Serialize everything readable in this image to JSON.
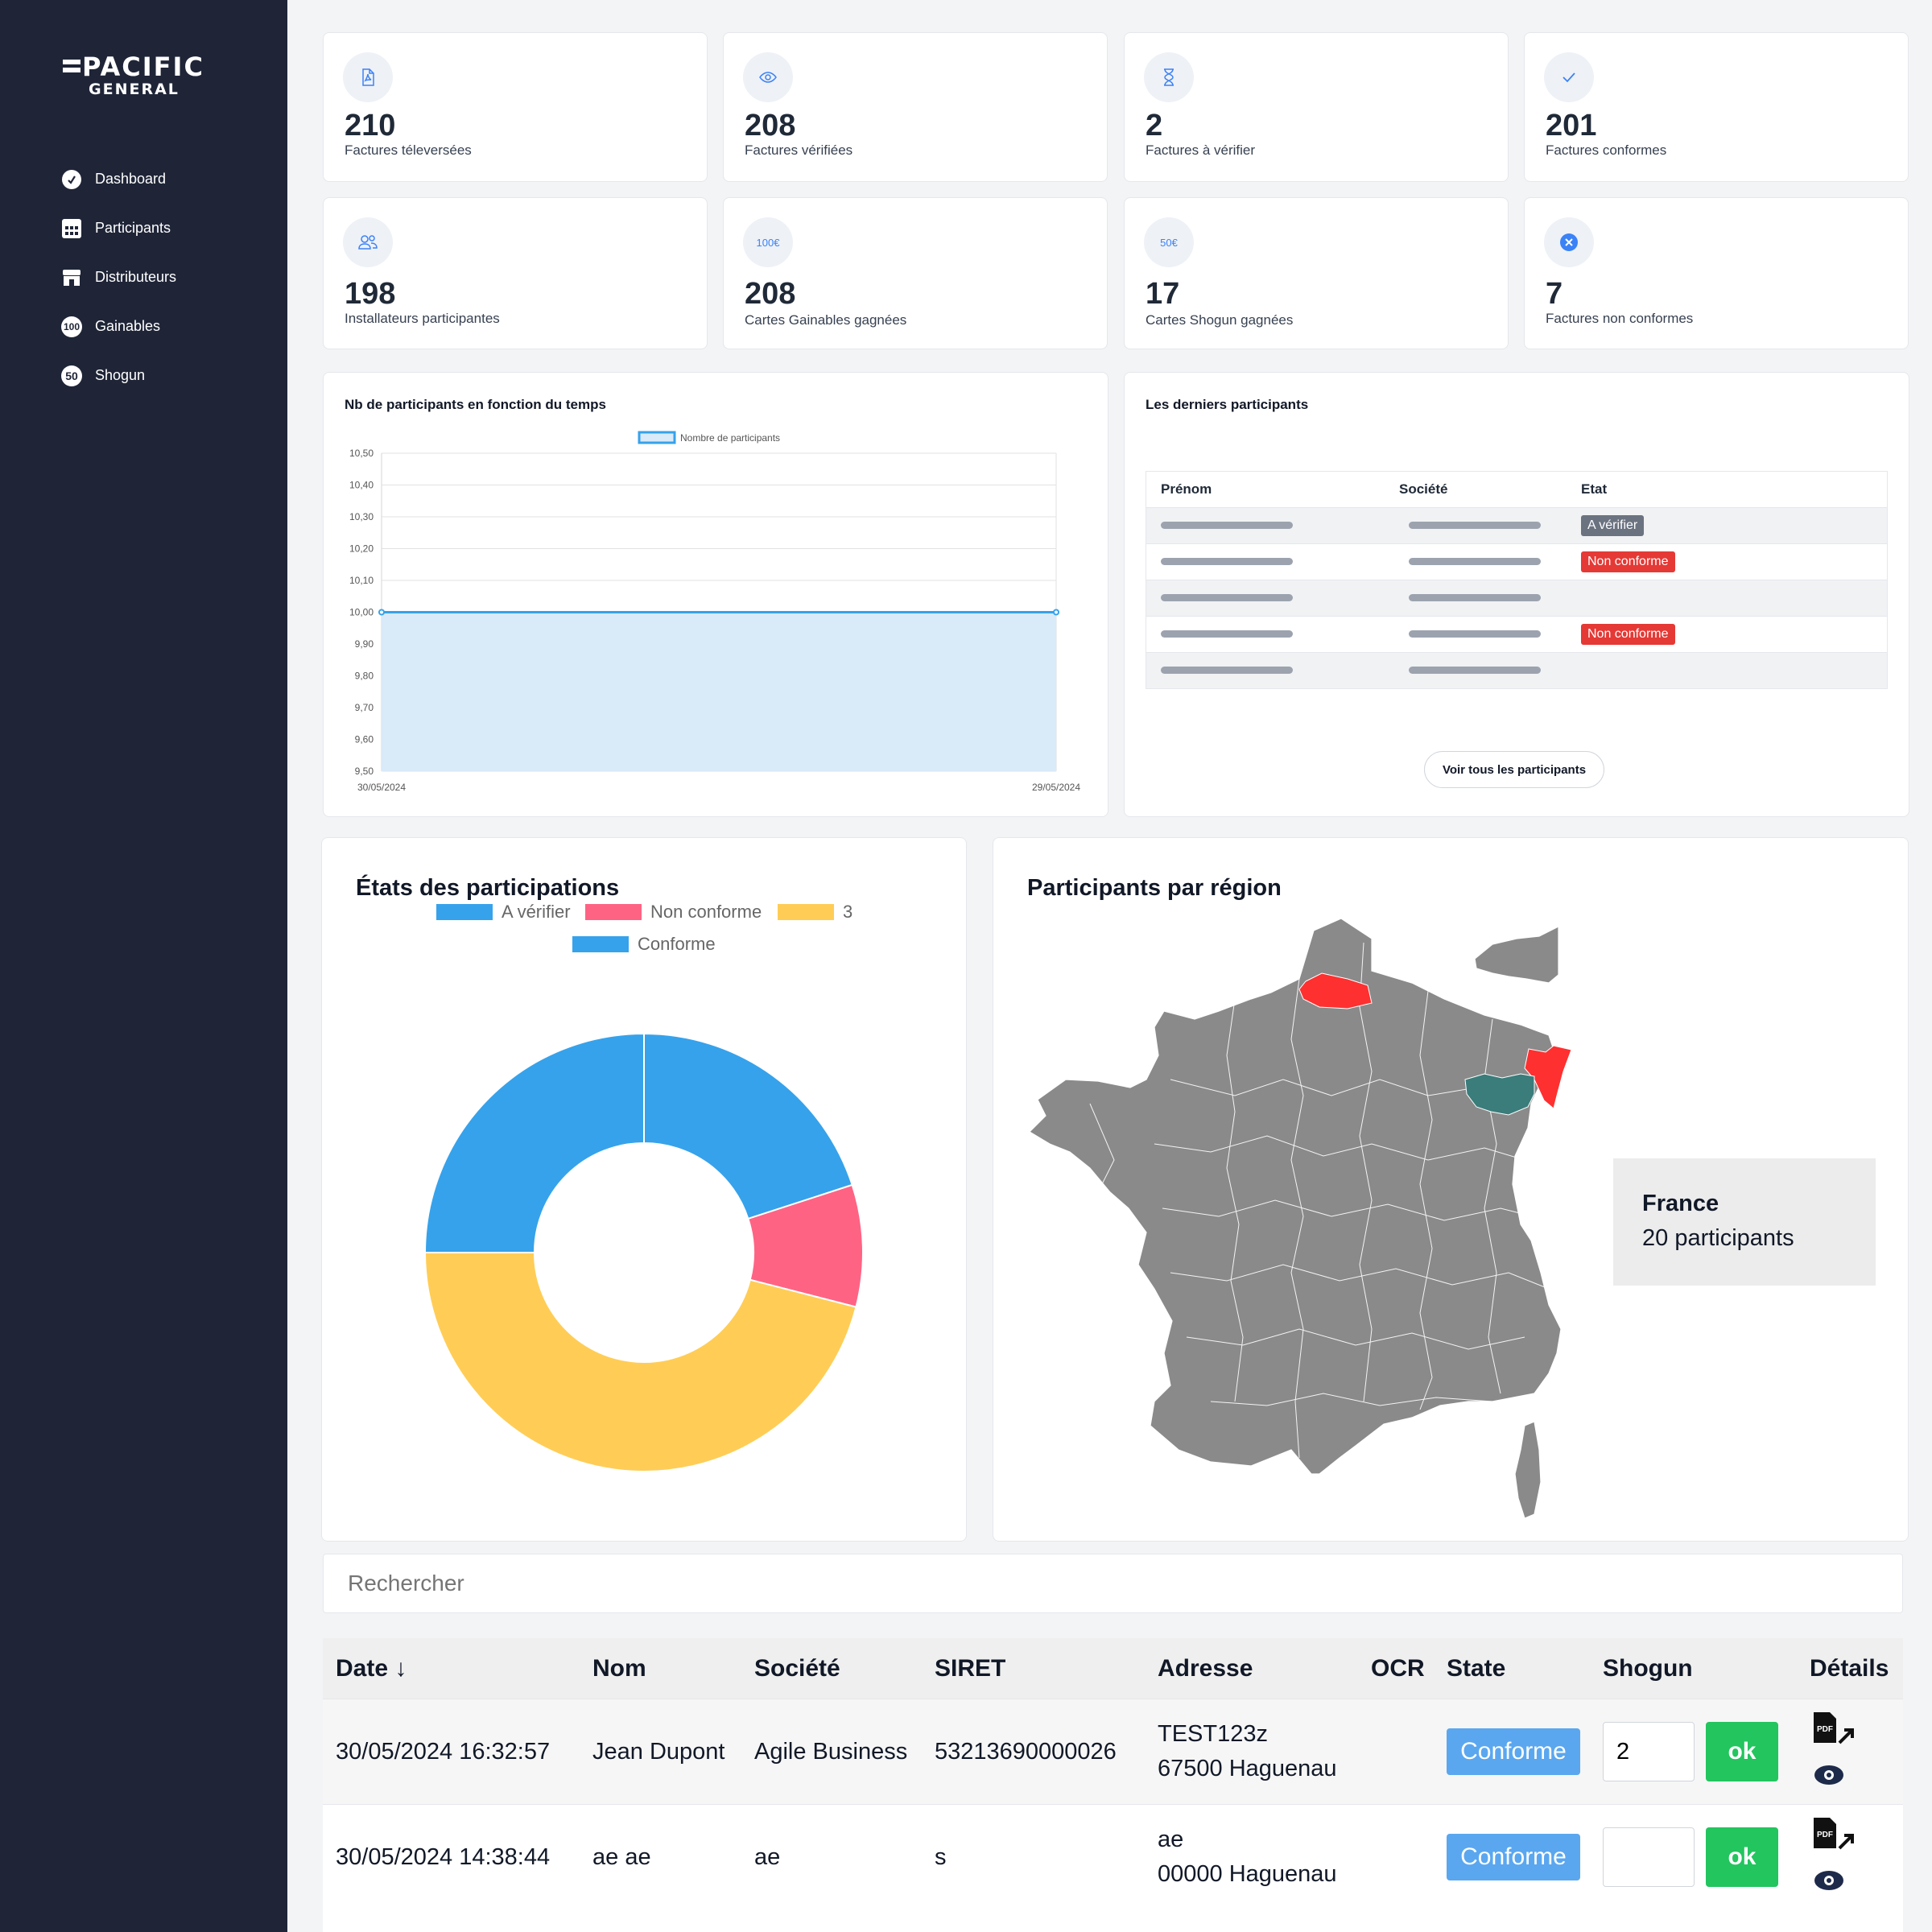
{
  "brand": {
    "line1": "PACIFIC",
    "line2": "GENERAL"
  },
  "nav": [
    {
      "label": "Dashboard",
      "icon": "gauge-icon"
    },
    {
      "label": "Participants",
      "icon": "grid-icon"
    },
    {
      "label": "Distributeurs",
      "icon": "store-icon"
    },
    {
      "label": "Gainables",
      "icon": "badge-100-icon",
      "badge": "100"
    },
    {
      "label": "Shogun",
      "icon": "badge-50-icon",
      "badge": "50"
    }
  ],
  "stats": [
    {
      "value": "210",
      "label": "Factures téleversées",
      "icon": "pdf-file-icon"
    },
    {
      "value": "208",
      "label": "Factures vérifiées",
      "icon": "eye-icon"
    },
    {
      "value": "2",
      "label": "Factures à vérifier",
      "icon": "hourglass-icon"
    },
    {
      "value": "201",
      "label": "Factures conformes",
      "icon": "check-icon"
    },
    {
      "value": "198",
      "label": "Installateurs participantes",
      "icon": "users-icon"
    },
    {
      "value": "208",
      "label": "Cartes Gainables gagnées",
      "icon": "amount-100-icon",
      "icon_text": "100€"
    },
    {
      "value": "17",
      "label": "Cartes Shogun gagnées",
      "icon": "amount-50-icon",
      "icon_text": "50€"
    },
    {
      "value": "7",
      "label": "Factures non conformes",
      "icon": "x-circle-icon"
    }
  ],
  "line_card": {
    "title": "Nb de participants en fonction du temps"
  },
  "recent": {
    "title": "Les derniers participants",
    "headers": [
      "Prénom",
      "Société",
      "Etat"
    ],
    "rows": [
      {
        "etat": "A vérifier",
        "kind": "grey"
      },
      {
        "etat": "Non conforme",
        "kind": "red"
      },
      {
        "etat": "",
        "kind": ""
      },
      {
        "etat": "Non conforme",
        "kind": "red"
      },
      {
        "etat": "",
        "kind": ""
      }
    ],
    "button": "Voir tous les participants"
  },
  "donut_card": {
    "title": "États des participations"
  },
  "map_card": {
    "title": "Participants par région",
    "info_title": "France",
    "info_value": "20 participants",
    "colors": {
      "base": "#8a8a8a",
      "red": "#ff3030",
      "teal": "#3a7d7b"
    }
  },
  "search": {
    "placeholder": "Rechercher"
  },
  "table": {
    "headers": {
      "date": "Date ↓",
      "nom": "Nom",
      "societe": "Société",
      "siret": "SIRET",
      "adresse": "Adresse",
      "ocr": "OCR",
      "state": "State",
      "shogun": "Shogun",
      "details": "Détails"
    },
    "rows": [
      {
        "date": "30/05/2024 16:32:57",
        "nom": "Jean Dupont",
        "societe": "Agile Business",
        "siret": "53213690000026",
        "adresse1": "TEST123z",
        "adresse2": "67500 Haguenau",
        "state": "Conforme",
        "shogun": "2",
        "ok": "ok"
      },
      {
        "date": "30/05/2024 14:38:44",
        "nom": "ae ae",
        "societe": "ae",
        "siret": "s",
        "adresse1": "ae",
        "adresse2": "00000 Haguenau",
        "state": "Conforme",
        "shogun": "",
        "ok": "ok"
      }
    ]
  },
  "chart_data": [
    {
      "type": "line",
      "title": "Nb de participants en fonction du temps",
      "x": [
        "30/05/2024",
        "29/05/2024"
      ],
      "series": [
        {
          "name": "Nombre de participants",
          "values": [
            10,
            10
          ]
        }
      ],
      "ylim": [
        9.5,
        10.5
      ],
      "yticks": [
        "10,50",
        "10,40",
        "10,30",
        "10,20",
        "10,10",
        "10,00",
        "9,90",
        "9,80",
        "9,70",
        "9,60",
        "9,50"
      ],
      "fill": true,
      "grid": true,
      "legend": "top",
      "colors": {
        "line": "#36a2eb",
        "fill": "#d9eaf9"
      }
    },
    {
      "type": "pie",
      "subtype": "doughnut",
      "categories": [
        "A vérifier",
        "Non conforme",
        "3",
        "Conforme"
      ],
      "values": [
        20,
        9,
        46,
        25
      ],
      "colors": [
        "#36a2eb",
        "#ff6384",
        "#ffcd56",
        "#36a2eb"
      ],
      "legend": "top"
    }
  ]
}
